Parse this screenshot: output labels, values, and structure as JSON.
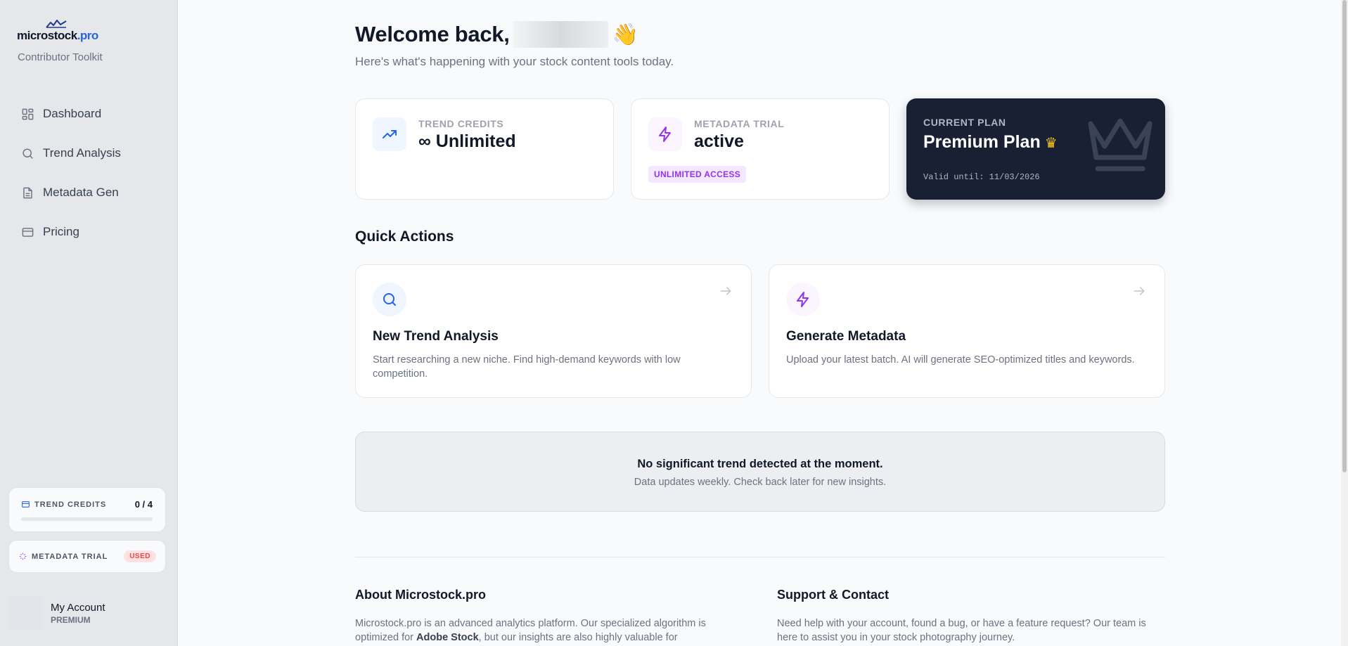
{
  "brand": {
    "logo_text": "microstock",
    "logo_suffix": ".pro",
    "tagline": "Contributor Toolkit",
    "accent": "#2563eb"
  },
  "sidebar": {
    "items": [
      {
        "label": "Dashboard",
        "icon": "dashboard-icon"
      },
      {
        "label": "Trend Analysis",
        "icon": "search-icon"
      },
      {
        "label": "Metadata Gen",
        "icon": "document-icon"
      },
      {
        "label": "Pricing",
        "icon": "credit-card-icon"
      }
    ],
    "credits": {
      "label": "TREND CREDITS",
      "count": "0 / 4",
      "progress": 0
    },
    "trial": {
      "label": "METADATA TRIAL",
      "badge": "USED"
    },
    "account": {
      "name": "My Account",
      "plan": "PREMIUM"
    }
  },
  "header": {
    "greeting": "Welcome back,",
    "emoji": "👋",
    "subtitle": "Here's what's happening with your stock content tools today."
  },
  "stats": {
    "credits": {
      "label": "TREND CREDITS",
      "value": "∞ Unlimited"
    },
    "trial": {
      "label": "METADATA TRIAL",
      "value": "active",
      "badge": "UNLIMITED ACCESS"
    },
    "plan": {
      "label": "CURRENT PLAN",
      "value": "Premium Plan",
      "crown": "♛",
      "valid": "Valid until: 11/03/2026"
    }
  },
  "quick_actions": {
    "title": "Quick Actions",
    "items": [
      {
        "title": "New Trend Analysis",
        "desc": "Start researching a new niche. Find high-demand keywords with low competition."
      },
      {
        "title": "Generate Metadata",
        "desc": "Upload your latest batch. AI will generate SEO-optimized titles and keywords."
      }
    ]
  },
  "trend": {
    "title": "No significant trend detected at the moment.",
    "subtitle": "Data updates weekly. Check back later for new insights."
  },
  "footer": {
    "about": {
      "title": "About Microstock.pro",
      "text_before": "Microstock.pro is an advanced analytics platform. Our specialized algorithm is optimized for ",
      "text_bold": "Adobe Stock",
      "text_after": ", but our insights are also highly valuable for"
    },
    "support": {
      "title": "Support & Contact",
      "text": "Need help with your account, found a bug, or have a feature request? Our team is here to assist you in your stock photography journey."
    }
  },
  "colors": {
    "purple": "#9333ea",
    "dark_card": "#1a2033",
    "gold": "#facc15"
  }
}
